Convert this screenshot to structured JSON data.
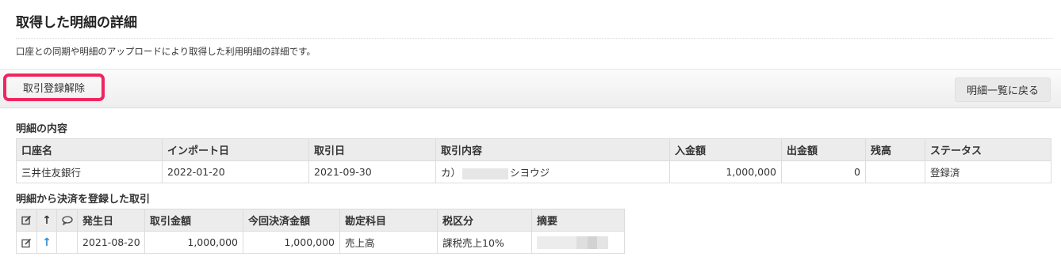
{
  "page": {
    "title": "取得した明細の詳細",
    "description": "口座との同期や明細のアップロードにより取得した利用明細の詳細です。"
  },
  "toolbar": {
    "unlink_button": "取引登録解除",
    "back_button": "明細一覧に戻る"
  },
  "statement": {
    "section_title": "明細の内容",
    "headers": [
      "口座名",
      "インポート日",
      "取引日",
      "取引内容",
      "入金額",
      "出金額",
      "残高",
      "ステータス"
    ],
    "row": {
      "account": "三井住友銀行",
      "import_date": "2022-01-20",
      "transaction_date": "2021-09-30",
      "content_prefix": "カ）",
      "content_suffix": "シヨウジ",
      "deposit": "1,000,000",
      "withdrawal": "0",
      "balance": "",
      "status": "登録済"
    }
  },
  "transactions": {
    "section_title": "明細から決済を登録した取引",
    "header_icons": [
      "edit-icon",
      "arrow-up-icon",
      "comment-icon"
    ],
    "headers": [
      "発生日",
      "取引金額",
      "今回決済金額",
      "勘定科目",
      "税区分",
      "摘要"
    ],
    "row": {
      "date": "2021-08-20",
      "amount": "1,000,000",
      "settled_amount": "1,000,000",
      "account_item": "売上高",
      "tax_category": "課税売上10%",
      "memo": ""
    }
  },
  "colors": {
    "highlight": "#f0255f",
    "arrow_up": "#2d8ed8",
    "header_bg": "#ececec"
  }
}
